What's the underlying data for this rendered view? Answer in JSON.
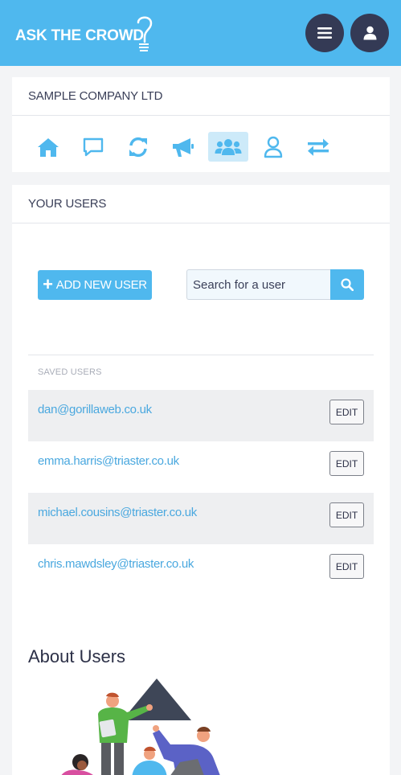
{
  "header": {
    "logo_text": "ASK THE CROWD",
    "menu_icon": "hamburger-icon",
    "account_icon": "user-icon",
    "colors": {
      "bar": "#4fb8ee",
      "circle_button": "#343a55"
    }
  },
  "company": {
    "name": "SAMPLE COMPANY LTD",
    "nav": [
      {
        "icon": "home-icon",
        "active": false
      },
      {
        "icon": "chat-icon",
        "active": false
      },
      {
        "icon": "refresh-icon",
        "active": false
      },
      {
        "icon": "megaphone-icon",
        "active": false
      },
      {
        "icon": "users-icon",
        "active": true
      },
      {
        "icon": "user-outline-icon",
        "active": false
      },
      {
        "icon": "transfer-icon",
        "active": false
      }
    ]
  },
  "users_panel": {
    "title": "YOUR USERS",
    "add_button_label": "ADD NEW USER",
    "search": {
      "placeholder": "Search for a user",
      "value": "",
      "icon": "search-icon"
    },
    "saved_label": "SAVED USERS",
    "edit_label": "EDIT",
    "users": [
      {
        "email": "dan@gorillaweb.co.uk"
      },
      {
        "email": "emma.harris@triaster.co.uk"
      },
      {
        "email": "michael.cousins@triaster.co.uk"
      },
      {
        "email": "chris.mawdsley@triaster.co.uk"
      }
    ]
  },
  "about": {
    "title": "About Users"
  }
}
